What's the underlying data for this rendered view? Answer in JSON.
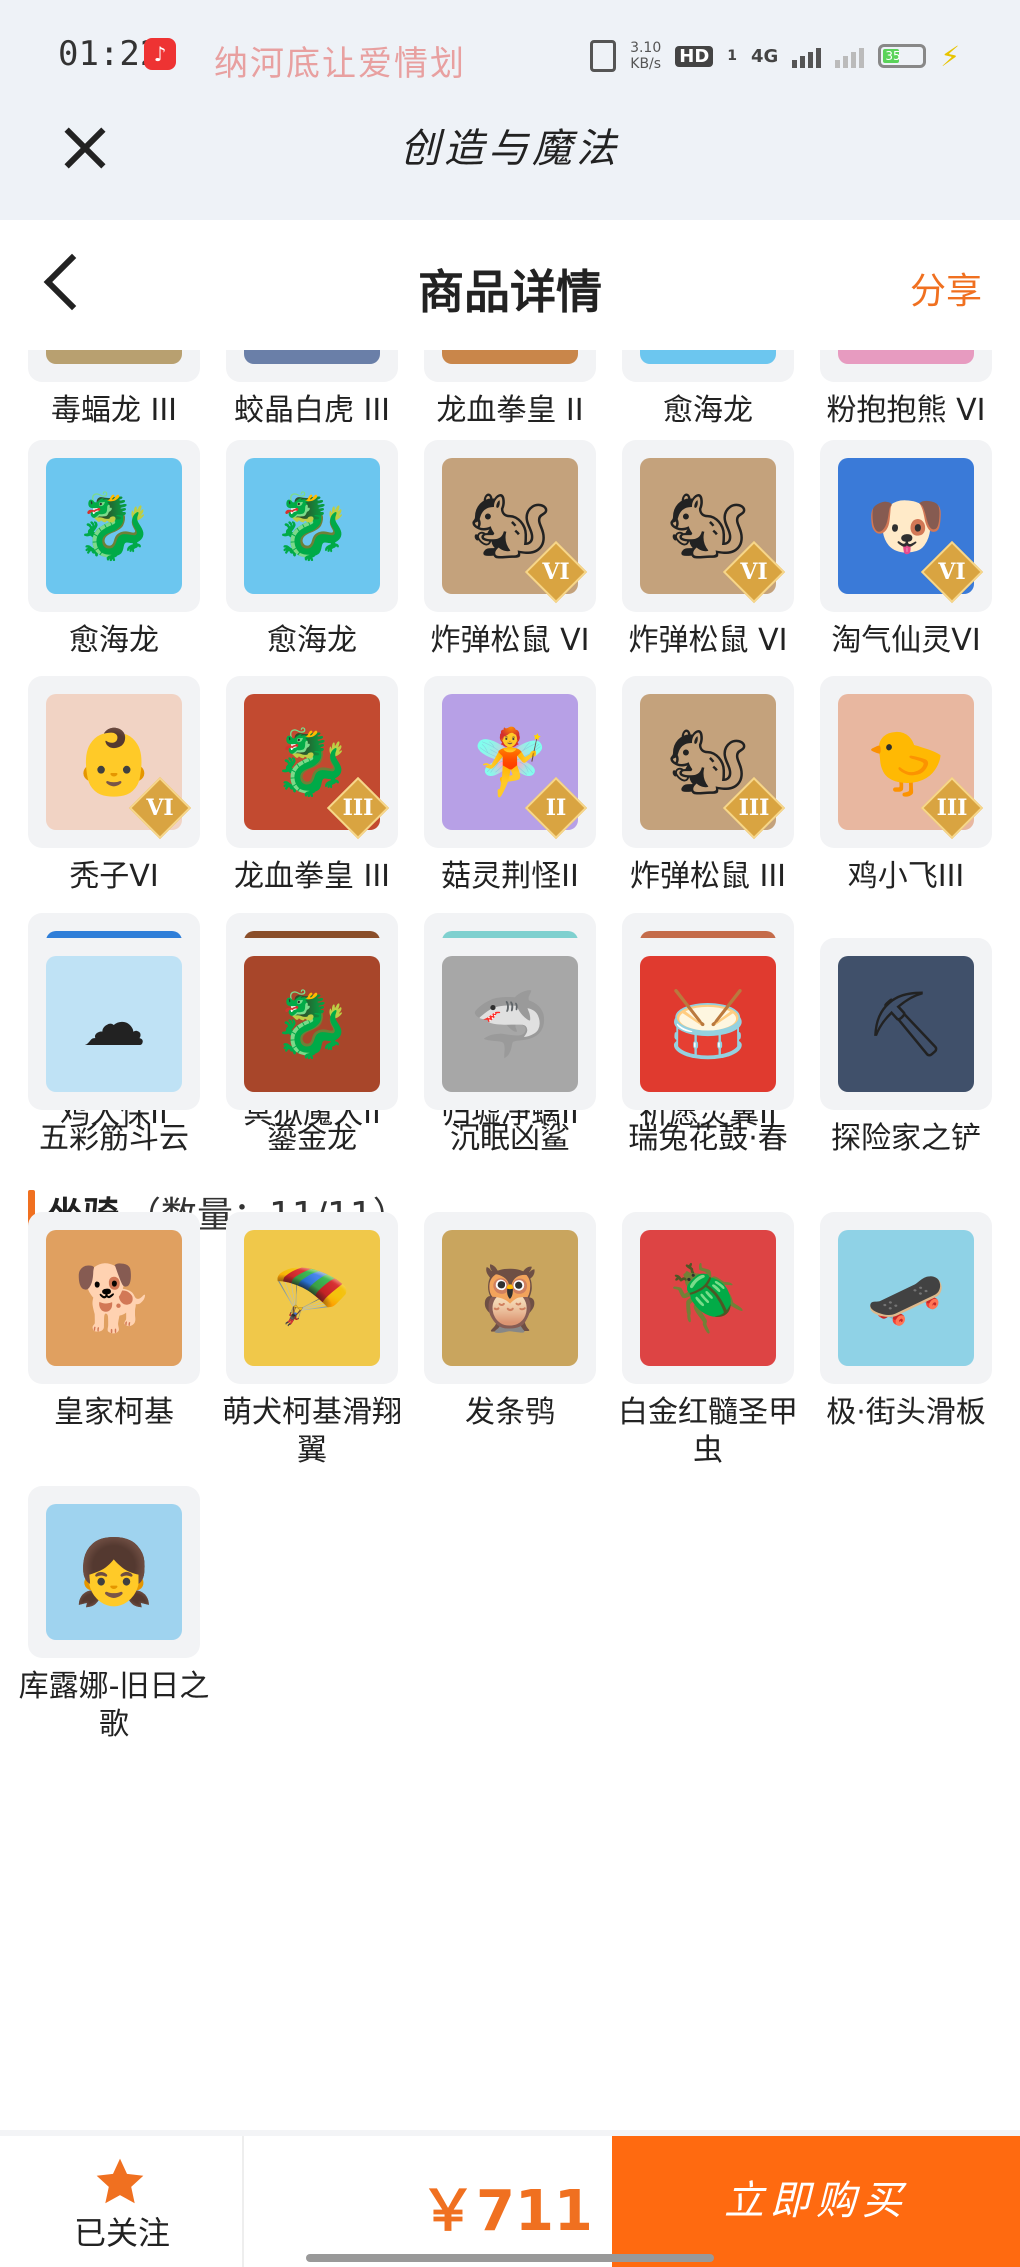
{
  "status_bar": {
    "time": "01:22",
    "ticker": "纳河底让爱情划",
    "net_speed": "3.10",
    "net_unit": "KB/s",
    "hd": "HD",
    "hd_sub": "1",
    "signal": "4G",
    "battery": "35"
  },
  "app_bar": {
    "title": "创造与魔法"
  },
  "nav": {
    "title": "商品详情",
    "share": "分享"
  },
  "pets": [
    {
      "label": "毒蝠龙 III",
      "icon": "dragon-icon",
      "color": "#b8a070",
      "tier": ""
    },
    {
      "label": "蛟晶白虎 III",
      "icon": "tiger-icon",
      "color": "#6a7fa8",
      "tier": ""
    },
    {
      "label": "龙血拳皇 II",
      "icon": "dragon-icon",
      "color": "#c9864a",
      "tier": ""
    },
    {
      "label": "愈海龙",
      "icon": "dragon-icon",
      "color": "#6cc6ef",
      "tier": ""
    },
    {
      "label": "粉抱抱熊 VI",
      "icon": "bear-icon",
      "color": "#e79bc0",
      "tier": ""
    },
    {
      "label": "愈海龙",
      "icon": "dragon-icon",
      "color": "#6cc6ef",
      "tier": ""
    },
    {
      "label": "愈海龙",
      "icon": "dragon-icon",
      "color": "#6cc6ef",
      "tier": ""
    },
    {
      "label": "炸弹松鼠 VI",
      "icon": "squirrel-icon",
      "color": "#c4a27c",
      "tier": "VI"
    },
    {
      "label": "炸弹松鼠 VI",
      "icon": "squirrel-icon",
      "color": "#c4a27c",
      "tier": "VI"
    },
    {
      "label": "淘气仙灵VI",
      "icon": "dog-icon",
      "color": "#3a7ad8",
      "tier": "VI"
    },
    {
      "label": "秃子VI",
      "icon": "baby-icon",
      "color": "#f1d3c4",
      "tier": "VI"
    },
    {
      "label": "龙血拳皇 III",
      "icon": "dragon-icon",
      "color": "#c24a30",
      "tier": "III"
    },
    {
      "label": "菇灵荆怪II",
      "icon": "sprite-icon",
      "color": "#b7a0e6",
      "tier": "II"
    },
    {
      "label": "炸弹松鼠 III",
      "icon": "squirrel-icon",
      "color": "#c4a27c",
      "tier": "III"
    },
    {
      "label": "鸡小飞III",
      "icon": "chick-icon",
      "color": "#e8b7a0",
      "tier": "III"
    },
    {
      "label": "鸡大保II",
      "icon": "chicken-icon",
      "color": "#2f7ed8",
      "tier": "II"
    },
    {
      "label": "冥狱魔犬II",
      "icon": "hound-icon",
      "color": "#8a4e2a",
      "tier": "II"
    },
    {
      "label": "归墟净螭II",
      "icon": "dragon-icon",
      "color": "#7fd0cf",
      "tier": "II"
    },
    {
      "label": "祈愿灵翼II",
      "icon": "bird-icon",
      "color": "#c46b4a",
      "tier": "II"
    }
  ],
  "mounts_section": {
    "title": "坐骑",
    "count": "（数量：11/11）"
  },
  "mounts": [
    {
      "label": "五彩筋斗云",
      "icon": "cloud-icon",
      "color": "#bfe2f5"
    },
    {
      "label": "鎏金龙",
      "icon": "dragon-icon",
      "color": "#a8462a"
    },
    {
      "label": "沉眠凶鲨",
      "icon": "shark-icon",
      "color": "#a7a7a7"
    },
    {
      "label": "瑞兔花鼓·春",
      "icon": "drum-icon",
      "color": "#e03a2f"
    },
    {
      "label": "探险家之铲",
      "icon": "shovel-icon",
      "color": "#40506a"
    },
    {
      "label": "皇家柯基",
      "icon": "corgi-icon",
      "color": "#e0a060"
    },
    {
      "label": "萌犬柯基滑翔翼",
      "icon": "glider-icon",
      "color": "#f0c84a"
    },
    {
      "label": "发条鸮",
      "icon": "owl-icon",
      "color": "#c9a55e"
    },
    {
      "label": "白金红髓圣甲虫",
      "icon": "beetle-icon",
      "color": "#d44"
    },
    {
      "label": "极·街头滑板",
      "icon": "skateboard-icon",
      "color": "#8fd2e6"
    },
    {
      "label": "库露娜-旧日之歌",
      "icon": "girl-icon",
      "color": "#9fd3ef"
    }
  ],
  "footer": {
    "follow_label": "已关注",
    "price": "￥711",
    "buy_label": "立即购买"
  },
  "colors": {
    "accent": "#f07020",
    "buy_bg": "#ff6a10",
    "thumb_bg": "#f2f3f5"
  }
}
